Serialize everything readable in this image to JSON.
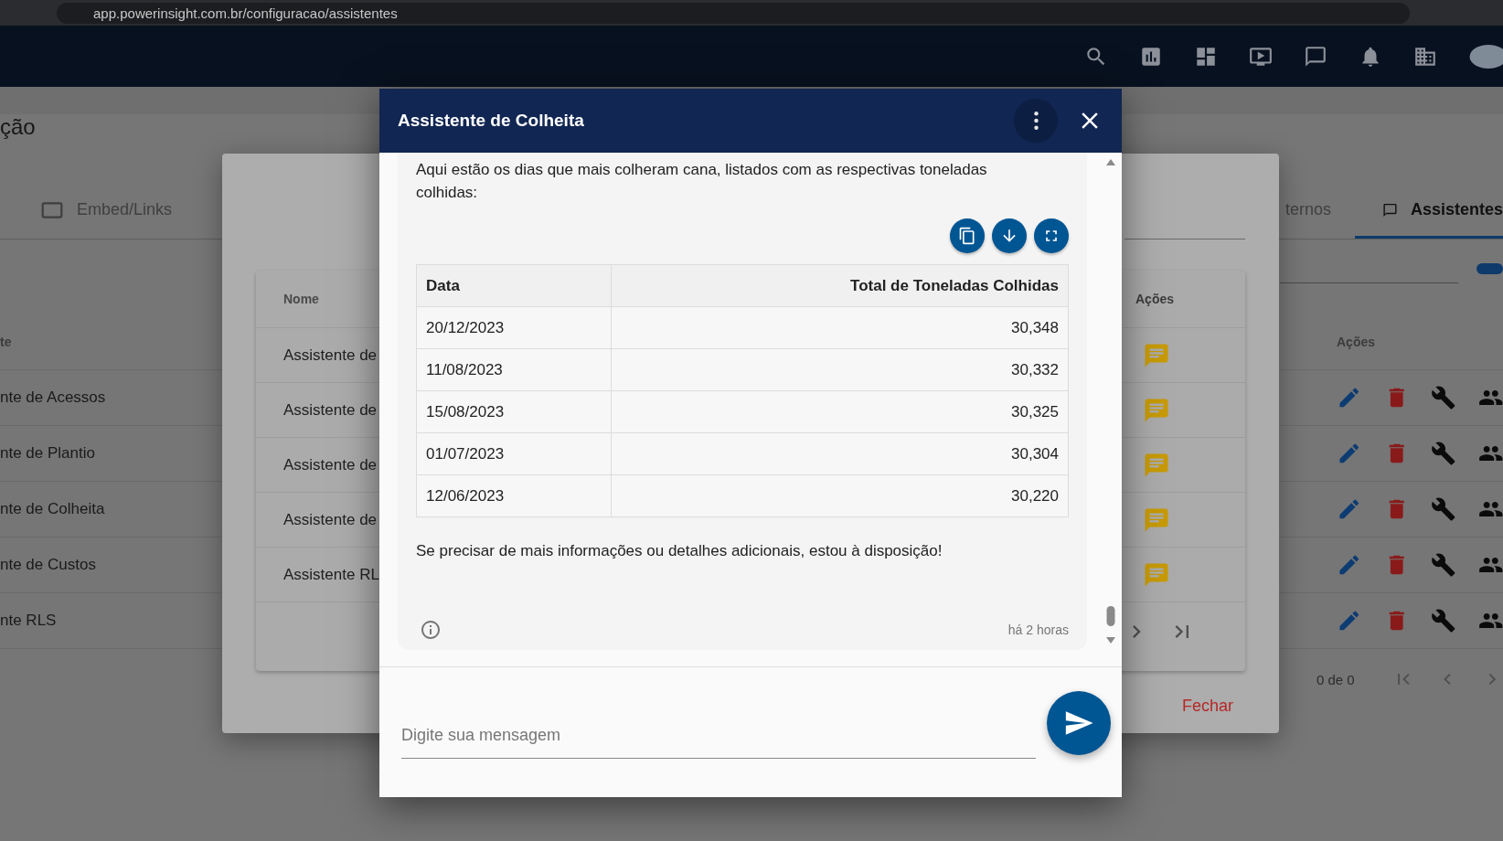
{
  "browser": {
    "url": "app.powerinsight.com.br/configuracao/assistentes"
  },
  "page": {
    "title": "ção",
    "tabs": [
      {
        "label": "Embed/Links",
        "selected": false
      },
      {
        "label": "ternos",
        "selected": false
      },
      {
        "label": "Assistentes",
        "selected": true
      }
    ],
    "table": {
      "columns": [
        "te",
        "Ações"
      ],
      "rows": [
        "nte de Acessos",
        "nte de Plantio",
        "nte de Colheita",
        "nte de Custos",
        "nte RLS"
      ]
    },
    "pagination": "0 de 0",
    "toggle": {
      "on": true
    }
  },
  "assistants_dialog": {
    "columns": [
      "Nome",
      "Ações"
    ],
    "rows": [
      "Assistente de",
      "Assistente de",
      "Assistente de",
      "Assistente de",
      "Assistente RL"
    ],
    "close_button": "Fechar"
  },
  "chat": {
    "title": "Assistente de Colheita",
    "message": {
      "intro": "Aqui estão os dias que mais colheram cana, listados com as respectivas toneladas colhidas:",
      "table": {
        "columns": [
          "Data",
          "Total de Toneladas Colhidas"
        ],
        "rows": [
          [
            "20/12/2023",
            "30,348"
          ],
          [
            "11/08/2023",
            "30,332"
          ],
          [
            "15/08/2023",
            "30,325"
          ],
          [
            "01/07/2023",
            "30,304"
          ],
          [
            "12/06/2023",
            "30,220"
          ]
        ]
      },
      "outro": "Se precisar de mais informações ou detalhes adicionais, estou à disposição!",
      "time": "há 2 horas"
    },
    "input": {
      "placeholder": "Digite sua mensagem"
    }
  }
}
